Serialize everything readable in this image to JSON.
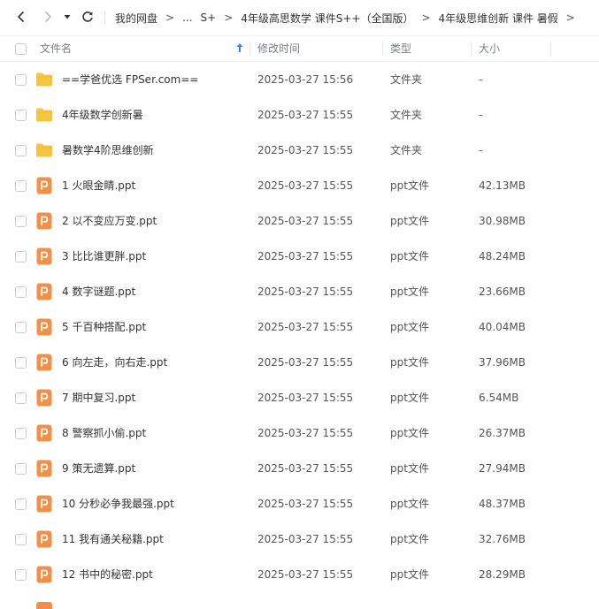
{
  "breadcrumb": {
    "items": [
      "我的网盘",
      "...",
      "S+",
      "4年级高思数学 课件S++（全国版）",
      "4年级思维创新 课件 暑假"
    ],
    "separator": ">"
  },
  "header": {
    "name": "文件名",
    "modified": "修改时间",
    "type": "类型",
    "size": "大小"
  },
  "colors": {
    "folder": "#F7C544",
    "ppt": "#F28F49",
    "sort_arrow": "#2a8bf2"
  },
  "files": [
    {
      "icon": "folder-icon",
      "name": "==学爸优选 FPSer.com==",
      "modified": "2025-03-27 15:56",
      "type": "文件夹",
      "size": "-"
    },
    {
      "icon": "folder-icon",
      "name": "4年级数学创新暑",
      "modified": "2025-03-27 15:55",
      "type": "文件夹",
      "size": "-"
    },
    {
      "icon": "folder-icon",
      "name": "暑数学4阶思维创新",
      "modified": "2025-03-27 15:55",
      "type": "文件夹",
      "size": "-"
    },
    {
      "icon": "ppt-icon",
      "name": "1 火眼金睛.ppt",
      "modified": "2025-03-27 15:55",
      "type": "ppt文件",
      "size": "42.13MB"
    },
    {
      "icon": "ppt-icon",
      "name": "2 以不变应万变.ppt",
      "modified": "2025-03-27 15:55",
      "type": "ppt文件",
      "size": "30.98MB"
    },
    {
      "icon": "ppt-icon",
      "name": "3 比比谁更胖.ppt",
      "modified": "2025-03-27 15:55",
      "type": "ppt文件",
      "size": "48.24MB"
    },
    {
      "icon": "ppt-icon",
      "name": "4 数字谜题.ppt",
      "modified": "2025-03-27 15:55",
      "type": "ppt文件",
      "size": "23.66MB"
    },
    {
      "icon": "ppt-icon",
      "name": "5 千百种搭配.ppt",
      "modified": "2025-03-27 15:55",
      "type": "ppt文件",
      "size": "40.04MB"
    },
    {
      "icon": "ppt-icon",
      "name": "6 向左走，向右走.ppt",
      "modified": "2025-03-27 15:55",
      "type": "ppt文件",
      "size": "37.96MB"
    },
    {
      "icon": "ppt-icon",
      "name": "7 期中复习.ppt",
      "modified": "2025-03-27 15:55",
      "type": "ppt文件",
      "size": "6.54MB"
    },
    {
      "icon": "ppt-icon",
      "name": "8 警察抓小偷.ppt",
      "modified": "2025-03-27 15:55",
      "type": "ppt文件",
      "size": "26.37MB"
    },
    {
      "icon": "ppt-icon",
      "name": "9 策无遗算.ppt",
      "modified": "2025-03-27 15:55",
      "type": "ppt文件",
      "size": "27.94MB"
    },
    {
      "icon": "ppt-icon",
      "name": "10 分秒必争我最强.ppt",
      "modified": "2025-03-27 15:55",
      "type": "ppt文件",
      "size": "48.37MB"
    },
    {
      "icon": "ppt-icon",
      "name": "11 我有通关秘籍.ppt",
      "modified": "2025-03-27 15:55",
      "type": "ppt文件",
      "size": "32.76MB"
    },
    {
      "icon": "ppt-icon",
      "name": "12 书中的秘密.ppt",
      "modified": "2025-03-27 15:55",
      "type": "ppt文件",
      "size": "28.29MB"
    }
  ]
}
